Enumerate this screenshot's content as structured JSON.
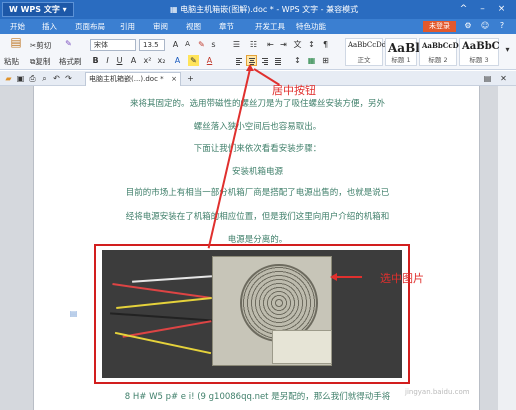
{
  "titlebar": {
    "app_label": "WPS 文字",
    "title": "电脑主机箱嵌(图解).doc * - WPS 文字 - 兼容模式",
    "minimize": "^",
    "restore": "–",
    "close": "×"
  },
  "menu": {
    "items": [
      "开始",
      "插入",
      "页面布局",
      "引用",
      "审阅",
      "视图",
      "章节",
      "开发工具",
      "特色功能"
    ],
    "login": "未登录",
    "icons": [
      "settings-icon",
      "help-icon",
      "question-icon"
    ]
  },
  "ribbon": {
    "paste": "粘贴",
    "cut": "剪切",
    "copy": "复制",
    "format_painter": "格式刷",
    "font_name": "宋体",
    "font_size": "13.5",
    "bold": "B",
    "italic": "I",
    "underline": "U",
    "styles": [
      {
        "sample": "AaBbCcDd",
        "name": "正文"
      },
      {
        "sample": "AaBl",
        "name": "标题 1"
      },
      {
        "sample": "AaBbCcDd",
        "name": "标题 2"
      },
      {
        "sample": "AaBbC",
        "name": "标题 3"
      }
    ]
  },
  "tabs": {
    "doc_tab": "电脑主机箱嵌(...).doc *",
    "close": "×",
    "add": "+"
  },
  "document": {
    "lines": [
      "来将其固定的。选用带磁性的螺丝刀是为了吸住螺丝安装方便，另外",
      "螺丝落入狭小空间后也容易取出。",
      "下面让我们来依次看看安装步骤：",
      "安装机箱电源",
      "目前的市场上有相当一部分机箱厂商是搭配了电源出售的，也就是说已",
      "经将电源安装在了机箱的相应位置，但是我们这里向用户介绍的机箱和",
      "电源是分离的。",
      "8 H# W5 p# e  i! (9 g10086qq.net 是另配的，那么我们就得动手将"
    ]
  },
  "annotations": {
    "center_button": "居中按钮",
    "select_image": "选中图片"
  },
  "watermark": "jingyan.baidu.com",
  "colors": {
    "titlebar": "#2a6cc0",
    "accent_red": "#e0302e",
    "body_text": "#3f7f6a"
  }
}
